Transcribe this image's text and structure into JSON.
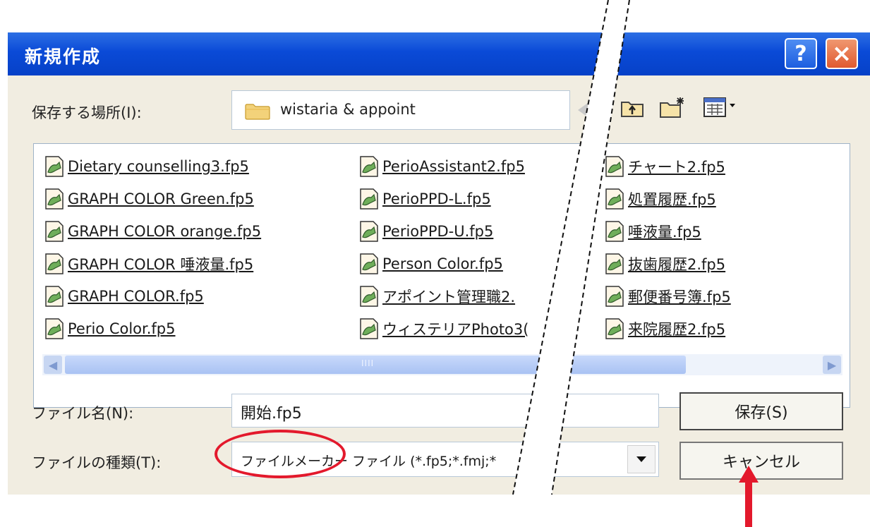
{
  "dialog": {
    "title": "新規作成",
    "title_buttons": {
      "help": "?",
      "close": "×"
    }
  },
  "location": {
    "label": "保存する場所(I):",
    "current": "wistaria & appoint"
  },
  "toolbar": {
    "icons": [
      "up-folder-icon",
      "new-folder-icon",
      "view-menu-icon"
    ]
  },
  "files": {
    "column1": [
      "Dietary counselling3.fp5",
      "GRAPH COLOR Green.fp5",
      "GRAPH COLOR orange.fp5",
      "GRAPH COLOR 唾液量.fp5",
      "GRAPH COLOR.fp5",
      "Perio Color.fp5"
    ],
    "column2": [
      "PerioAssistant2.fp5",
      "PerioPPD-L.fp5",
      "PerioPPD-U.fp5",
      "Person Color.fp5",
      "アポイント管理職2.",
      "ウィステリアPhoto3("
    ],
    "column3": [
      "チャート2.fp5",
      "処置履歴.fp5",
      "唾液量.fp5",
      "抜歯履歴2.fp5",
      "郵便番号簿.fp5",
      "来院履歴2.fp5"
    ]
  },
  "scrollbar": {
    "grip": "IIII"
  },
  "filename": {
    "label": "ファイル名(N):",
    "value": "開始.fp5"
  },
  "filetype": {
    "label": "ファイルの種類(T):",
    "value": "ファイルメーカー ファイル (*.fp5;*.fmj;*"
  },
  "buttons": {
    "save": "保存(S)",
    "cancel": "キャンセル"
  },
  "colors": {
    "titlebar": "#0a4ad7",
    "dialog_bg": "#f1ede1",
    "highlight": "#e3192c"
  }
}
